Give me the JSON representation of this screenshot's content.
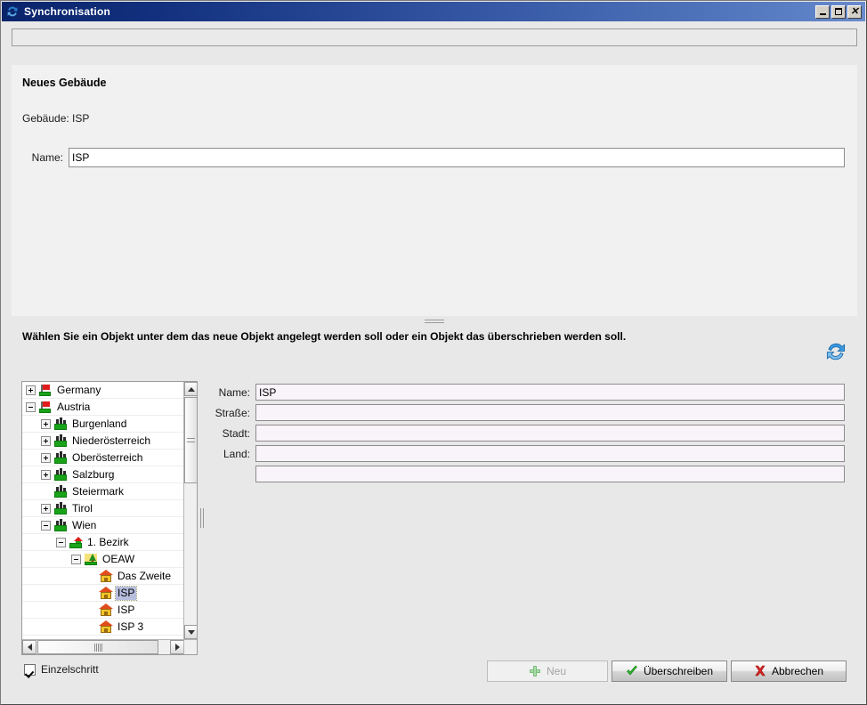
{
  "window": {
    "title": "Synchronisation",
    "icon": "sync-icon",
    "controls": {
      "minimize": "minimize-button",
      "maximize": "maximize-button",
      "close": "close-button"
    }
  },
  "status_field": {
    "value": "",
    "placeholder": ""
  },
  "upper_panel": {
    "heading": "Neues Gebäude",
    "context_label": "Gebäude: ISP",
    "name_field": {
      "label": "Name:",
      "value": "ISP",
      "placeholder": ""
    }
  },
  "instruction": "Wählen Sie ein Objekt unter dem das neue Objekt angelegt werden soll oder ein Objekt das überschrieben werden soll.",
  "refresh": {
    "icon": "refresh-icon",
    "tooltip": ""
  },
  "tree": {
    "items": [
      {
        "label": "Germany",
        "indent": 0,
        "expander": "plus",
        "icon": "country-flag-icon",
        "selected": false
      },
      {
        "label": "Austria",
        "indent": 0,
        "expander": "minus",
        "icon": "country-flag-icon",
        "selected": false
      },
      {
        "label": "Burgenland",
        "indent": 1,
        "expander": "plus",
        "icon": "region-city-icon",
        "selected": false
      },
      {
        "label": "Niederösterreich",
        "indent": 1,
        "expander": "plus",
        "icon": "region-city-icon",
        "selected": false
      },
      {
        "label": "Oberösterreich",
        "indent": 1,
        "expander": "plus",
        "icon": "region-city-icon",
        "selected": false
      },
      {
        "label": "Salzburg",
        "indent": 1,
        "expander": "plus",
        "icon": "region-city-icon",
        "selected": false
      },
      {
        "label": "Steiermark",
        "indent": 1,
        "expander": "none",
        "icon": "region-city-icon",
        "selected": false
      },
      {
        "label": "Tirol",
        "indent": 1,
        "expander": "plus",
        "icon": "region-city-icon",
        "selected": false
      },
      {
        "label": "Wien",
        "indent": 1,
        "expander": "minus",
        "icon": "region-city-icon",
        "selected": false
      },
      {
        "label": "1. Bezirk",
        "indent": 2,
        "expander": "minus",
        "icon": "district-house-icon",
        "selected": false
      },
      {
        "label": "OEAW",
        "indent": 3,
        "expander": "minus",
        "icon": "campus-park-icon",
        "selected": false
      },
      {
        "label": "Das Zweite",
        "indent": 4,
        "expander": "none",
        "icon": "building-house-icon",
        "selected": false
      },
      {
        "label": "ISP",
        "indent": 4,
        "expander": "none",
        "icon": "building-house-icon",
        "selected": true
      },
      {
        "label": "ISP",
        "indent": 4,
        "expander": "none",
        "icon": "building-house-icon",
        "selected": false
      },
      {
        "label": "ISP 3",
        "indent": 4,
        "expander": "none",
        "icon": "building-house-icon",
        "selected": false
      }
    ],
    "scrollbars": {
      "vertical": "tree-vertical-scrollbar",
      "horizontal": "tree-horizontal-scrollbar"
    }
  },
  "detail_form": {
    "rows": [
      {
        "label": "Name:",
        "value": "ISP",
        "placeholder": ""
      },
      {
        "label": "Straße:",
        "value": "",
        "placeholder": ""
      },
      {
        "label": "Stadt:",
        "value": "",
        "placeholder": ""
      },
      {
        "label": "Land:",
        "value": "",
        "placeholder": ""
      },
      {
        "label": "",
        "value": "",
        "placeholder": ""
      }
    ]
  },
  "bottom": {
    "checkbox": {
      "label": "Einzelschritt",
      "checked": true
    },
    "buttons": {
      "neu": {
        "label": "Neu",
        "icon": "plus-icon",
        "enabled": false
      },
      "ueberschreiben": {
        "label": "Überschreiben",
        "icon": "check-icon",
        "enabled": true
      },
      "abbrechen": {
        "label": "Abbrechen",
        "icon": "cross-icon",
        "enabled": true
      }
    }
  },
  "colors": {
    "title_bar_start": "#0a246a",
    "title_bar_end": "#6a8bcc",
    "window_bg": "#e8e8e8",
    "panel_bg": "#f1f1f1",
    "selection": "#b7bede",
    "accent_green": "#17a317",
    "accent_red": "#e01b1b",
    "accent_blue": "#3a85d0"
  }
}
